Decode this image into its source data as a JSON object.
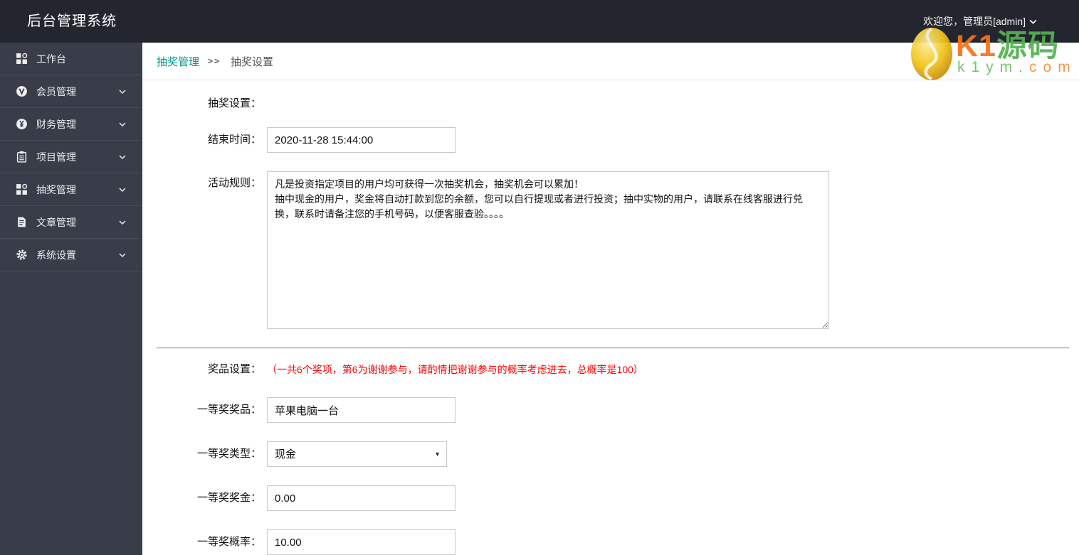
{
  "header": {
    "title": "后台管理系统",
    "welcome": "欢迎您，管理员[admin]"
  },
  "sidebar": {
    "items": [
      {
        "label": "工作台",
        "icon": "grid-icon",
        "expandable": false
      },
      {
        "label": "会员管理",
        "icon": "member-icon",
        "expandable": true
      },
      {
        "label": "财务管理",
        "icon": "finance-icon",
        "expandable": true
      },
      {
        "label": "项目管理",
        "icon": "project-icon",
        "expandable": true
      },
      {
        "label": "抽奖管理",
        "icon": "lottery-icon",
        "expandable": true
      },
      {
        "label": "文章管理",
        "icon": "article-icon",
        "expandable": true
      },
      {
        "label": "系统设置",
        "icon": "settings-icon",
        "expandable": true
      }
    ]
  },
  "breadcrumb": {
    "parent": "抽奖管理",
    "separator": ">>",
    "current": "抽奖设置"
  },
  "form": {
    "section_title": "抽奖设置：",
    "end_time": {
      "label": "结束时间：",
      "value": "2020-11-28 15:44:00"
    },
    "rules": {
      "label": "活动规则：",
      "value": "凡是投资指定项目的用户均可获得一次抽奖机会，抽奖机会可以累加！\n抽中现金的用户，奖金将自动打款到您的余额，您可以自行提现或者进行投资；抽中实物的用户，请联系在线客服进行兑换，联系时请备注您的手机号码，以便客服查验。。。。"
    },
    "prize_section": {
      "label": "奖品设置：",
      "hint": "（一共6个奖项，第6为谢谢参与，请酌情把谢谢参与的概率考虑进去，总概率是100）"
    },
    "prize_name": {
      "label": "一等奖奖品：",
      "value": "苹果电脑一台"
    },
    "prize_type": {
      "label": "一等奖类型：",
      "value": "现金"
    },
    "prize_money": {
      "label": "一等奖奖金：",
      "value": "0.00"
    },
    "prize_rate": {
      "label": "一等奖概率：",
      "value": "10.00"
    }
  },
  "watermark": {
    "brand_orange": "K1",
    "brand_green": "源码",
    "domain_green": "k1ym.",
    "domain_orange": "com"
  },
  "colors": {
    "header_bg": "#23262e",
    "sidebar_bg": "#393d49",
    "accent_teal": "#009688",
    "hint_red": "#ff0000"
  }
}
